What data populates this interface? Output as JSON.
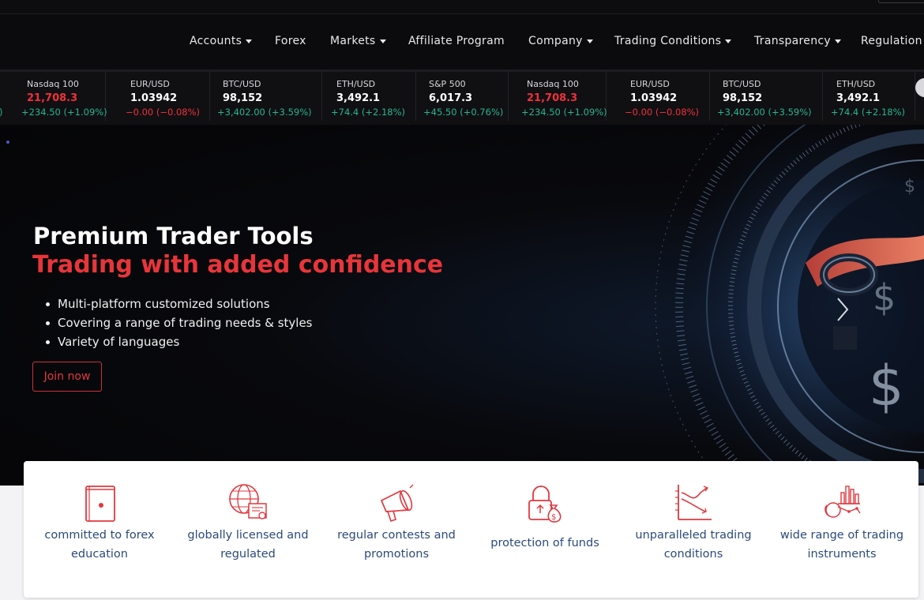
{
  "nav": {
    "items": [
      {
        "label": "Accounts",
        "dropdown": true
      },
      {
        "label": "Forex",
        "dropdown": false
      },
      {
        "label": "Markets",
        "dropdown": true
      },
      {
        "label": "Affiliate Program",
        "dropdown": false
      },
      {
        "label": "Company",
        "dropdown": true
      },
      {
        "label": "Trading Conditions",
        "dropdown": true
      },
      {
        "label": "Transparency",
        "dropdown": true
      },
      {
        "label": "Regulation",
        "dropdown": false
      }
    ]
  },
  "ticker": {
    "leading_change": ")",
    "items": [
      {
        "symbol": "Nasdaq 100",
        "price": "21,708.3",
        "change": "+234.50 (+1.09%)",
        "direction": "up",
        "price_color": "down"
      },
      {
        "symbol": "EUR/USD",
        "price": "1.03942",
        "change": "−0.00 (−0.08%)",
        "direction": "down",
        "price_color": "up"
      },
      {
        "symbol": "BTC/USD",
        "price": "98,152",
        "change": "+3,402.00 (+3.59%)",
        "direction": "up",
        "price_color": "up"
      },
      {
        "symbol": "ETH/USD",
        "price": "3,492.1",
        "change": "+74.4 (+2.18%)",
        "direction": "up",
        "price_color": "up"
      },
      {
        "symbol": "S&P 500",
        "price": "6,017.3",
        "change": "+45.50 (+0.76%)",
        "direction": "up",
        "price_color": "up"
      },
      {
        "symbol": "Nasdaq 100",
        "price": "21,708.3",
        "change": "+234.50 (+1.09%)",
        "direction": "up",
        "price_color": "down"
      },
      {
        "symbol": "EUR/USD",
        "price": "1.03942",
        "change": "−0.00 (−0.08%)",
        "direction": "down",
        "price_color": "up"
      },
      {
        "symbol": "BTC/USD",
        "price": "98,152",
        "change": "+3,402.00 (+3.59%)",
        "direction": "up",
        "price_color": "up"
      },
      {
        "symbol": "ETH/USD",
        "price": "3,492.1",
        "change": "+74.4 (+2.18%)",
        "direction": "up",
        "price_color": "up"
      }
    ]
  },
  "hero": {
    "title": "Premium Trader Tools",
    "subtitle": "Trading with added confidence",
    "bullets": [
      "Multi-platform customized solutions",
      "Covering a range of trading needs & styles",
      "Variety of languages"
    ],
    "cta_label": "Join now"
  },
  "features": [
    {
      "icon": "book-icon",
      "label": "committed to forex education"
    },
    {
      "icon": "globe-certificate-icon",
      "label": "globally licensed and regulated"
    },
    {
      "icon": "megaphone-icon",
      "label": "regular contests and promotions"
    },
    {
      "icon": "lock-moneybag-icon",
      "label": "protection of funds"
    },
    {
      "icon": "chart-arrows-icon",
      "label": "unparalleled trading conditions"
    },
    {
      "icon": "candlestick-hand-icon",
      "label": "wide range of trading instruments"
    }
  ],
  "colors": {
    "accent_red": "#e8353a",
    "up_green": "#2ab38c",
    "down_red": "#f0303a",
    "feature_text": "#2b4a7a"
  }
}
